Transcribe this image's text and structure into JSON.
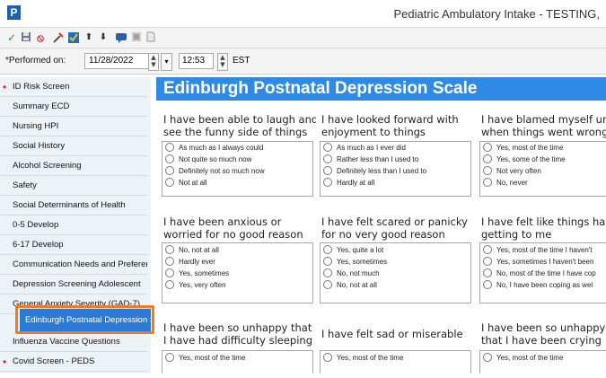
{
  "window": {
    "title": "Pediatric Ambulatory Intake - TESTING,",
    "logo_letter": "P"
  },
  "toolbar": {
    "icons": [
      "check-icon",
      "save-icon",
      "cancel-icon",
      "tool-icon",
      "form-icon",
      "up-arrow-icon",
      "down-arrow-icon",
      "chat-icon",
      "list-icon",
      "document-icon"
    ],
    "check": "✓",
    "cancel": "⦸",
    "up": "⬆",
    "down": "⬇"
  },
  "performed": {
    "label": "*Performed on:",
    "date": "11/28/2022",
    "time": "12:53",
    "tz": "EST"
  },
  "sidebar": {
    "items": [
      {
        "label": "ID Risk Screen",
        "required": true
      },
      {
        "label": "Summary ECD",
        "required": false
      },
      {
        "label": "Nursing HPI",
        "required": false
      },
      {
        "label": "Social History",
        "required": false
      },
      {
        "label": "Alcohol Screening",
        "required": false
      },
      {
        "label": "Safety",
        "required": false
      },
      {
        "label": "Social Determinants of Health",
        "required": false
      },
      {
        "label": "0-5 Develop",
        "required": false
      },
      {
        "label": "6-17 Develop",
        "required": false
      },
      {
        "label": "Communication Needs and Preference",
        "required": false
      },
      {
        "label": "Depression Screening Adolescent",
        "required": false
      },
      {
        "label": "General Anxiety Severity (GAD-7)",
        "required": false
      },
      {
        "label": "Edinburgh Postnatal Depression Scal",
        "required": false,
        "selected": true
      },
      {
        "label": "Influenza Vaccine Questions",
        "required": false
      },
      {
        "label": "Covid Screen - PEDS",
        "required": true
      }
    ],
    "required_marker": "•"
  },
  "main": {
    "title": "Edinburgh Postnatal Depression Scale",
    "questions": [
      {
        "line1": "I have been able to laugh and",
        "line2": "see the funny side of things",
        "options": [
          "As much as I always could",
          "Not quite so much now",
          "Definitely not so much now",
          "Not at all"
        ]
      },
      {
        "line1": "I have looked forward with",
        "line2": "enjoyment to things",
        "options": [
          "As much as I ever did",
          "Rather less than I used to",
          "Definitely less than I used to",
          "Hardly at all"
        ]
      },
      {
        "line1": "I have blamed myself unn",
        "line2": "when things went wrong",
        "options": [
          "Yes, most of the time",
          "Yes, some of the time",
          "Not very often",
          "No, never"
        ]
      },
      {
        "line1": "I have been anxious or",
        "line2": "worried for no good reason",
        "options": [
          "No, not at all",
          "Hardly ever",
          "Yes, sometimes",
          "Yes, very often"
        ]
      },
      {
        "line1": "I have felt scared or panicky",
        "line2": "for no very good reason",
        "options": [
          "Yes, quite a lot",
          "Yes, sometimes",
          "No, not much",
          "No, not at all"
        ]
      },
      {
        "line1": "I have felt like things hav",
        "line2": "getting to me",
        "options": [
          "Yes, most of the time I haven't",
          "Yes, sometimes I haven't been",
          "No, most of the time I have cop",
          "No, I have been coping as wel"
        ]
      },
      {
        "line1": "I have been so unhappy that",
        "line2": "I have had difficulty sleeping",
        "options": [
          "Yes, most of the time"
        ]
      },
      {
        "line1": "I have felt sad or miserable",
        "line2": "",
        "options": [
          "Yes, most of the time"
        ]
      },
      {
        "line1": "I have been so unhappy",
        "line2": "that I have been crying",
        "options": [
          "Yes, most of the time"
        ]
      }
    ]
  }
}
